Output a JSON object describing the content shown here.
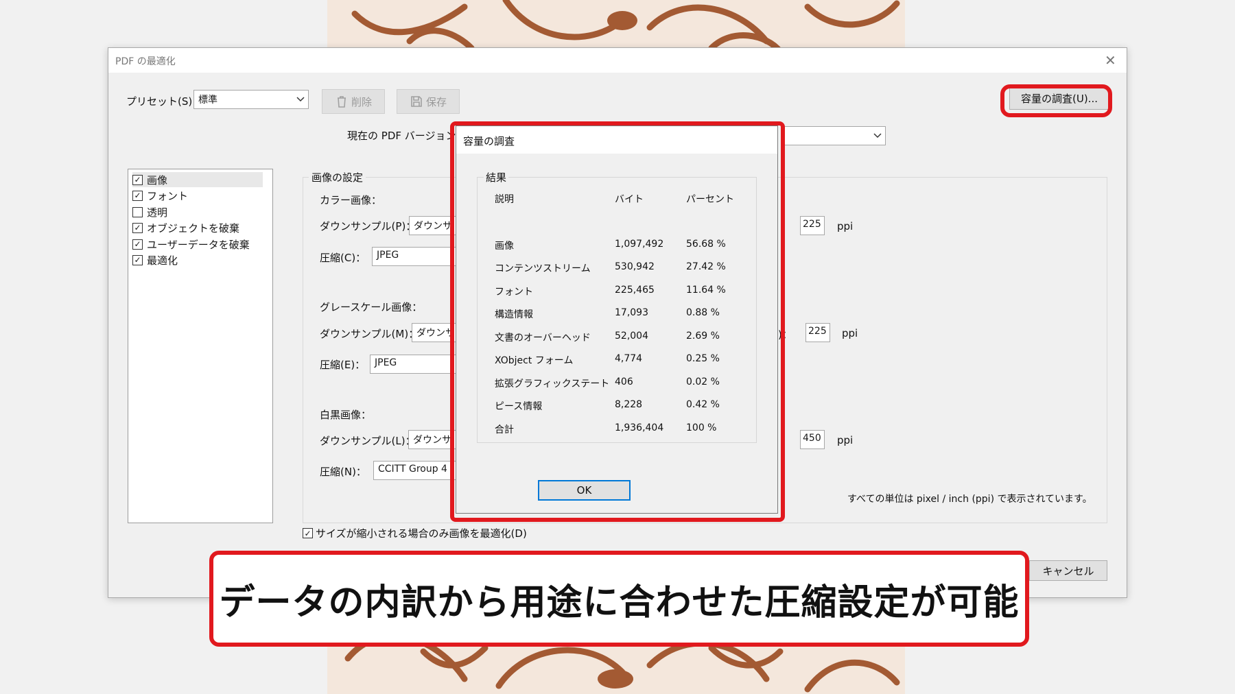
{
  "window": {
    "title": "PDF の最適化"
  },
  "toolbar": {
    "preset_label": "プリセット(S)：",
    "preset_value": "標準",
    "delete_label": "削除",
    "save_label": "保存",
    "audit_button_label": "容量の調査(U)...",
    "pdf_version_label": "現在の PDF バージョン："
  },
  "panel_list": {
    "items": [
      {
        "label": "画像",
        "checked": true
      },
      {
        "label": "フォント",
        "checked": true
      },
      {
        "label": "透明",
        "checked": false
      },
      {
        "label": "オブジェクトを破棄",
        "checked": true
      },
      {
        "label": "ユーザーデータを破棄",
        "checked": true
      },
      {
        "label": "最適化",
        "checked": true
      }
    ]
  },
  "image_settings": {
    "group_title": "画像の設定",
    "color": {
      "heading": "カラー画像：",
      "downsample_label": "ダウンサンプル(P)：",
      "downsample_value": "ダウンサ",
      "compression_label": "圧縮(C)：",
      "compression_value": "JPEG",
      "ppi_value": "225",
      "ppi_unit": "ppi",
      "ppi_label_fragment": "："
    },
    "grayscale": {
      "heading": "グレースケール画像：",
      "downsample_label": "ダウンサンプル(M)：",
      "downsample_value": "ダウンサ",
      "compression_label": "圧縮(E)：",
      "compression_value": "JPEG",
      "ppi_value": "225",
      "ppi_unit": "ppi",
      "ppi_label_fragment": ")："
    },
    "monochrome": {
      "heading": "白黒画像：",
      "downsample_label": "ダウンサンプル(L)：",
      "downsample_value": "ダウンサ",
      "compression_label": "圧縮(N)：",
      "compression_value": "CCITT Group 4",
      "ppi_value": "450",
      "ppi_unit": "ppi",
      "ppi_label_fragment": "："
    },
    "units_note": "すべての単位は pixel / inch (ppi) で表示されています。"
  },
  "optimize_only_if_smaller": {
    "label": "サイズが縮小される場合のみ画像を最適化(D)",
    "checked": true
  },
  "cancel_label": "キャンセル",
  "audit_dialog": {
    "title": "容量の調査",
    "results_title": "結果",
    "headers": {
      "description": "説明",
      "bytes": "バイト",
      "percent": "パーセント"
    },
    "rows": [
      {
        "description": "画像",
        "bytes": "1,097,492",
        "percent": "56.68 %"
      },
      {
        "description": "コンテンツストリーム",
        "bytes": "530,942",
        "percent": "27.42 %"
      },
      {
        "description": "フォント",
        "bytes": "225,465",
        "percent": "11.64 %"
      },
      {
        "description": "構造情報",
        "bytes": "17,093",
        "percent": "0.88 %"
      },
      {
        "description": "文書のオーバーヘッド",
        "bytes": "52,004",
        "percent": "2.69 %"
      },
      {
        "description": "XObject フォーム",
        "bytes": "4,774",
        "percent": "0.25 %"
      },
      {
        "description": "拡張グラフィックステート",
        "bytes": "406",
        "percent": "0.02 %"
      },
      {
        "description": "ピース情報",
        "bytes": "8,228",
        "percent": "0.42 %"
      },
      {
        "description": "合計",
        "bytes": "1,936,404",
        "percent": "100 %"
      }
    ],
    "ok_label": "OK"
  },
  "caption": {
    "text": "データの内訳から用途に合わせた圧縮設定が可能"
  },
  "colors": {
    "accent_red": "#e1191e",
    "ok_button_border": "#0078d7",
    "art_brown": "#a35a33"
  }
}
